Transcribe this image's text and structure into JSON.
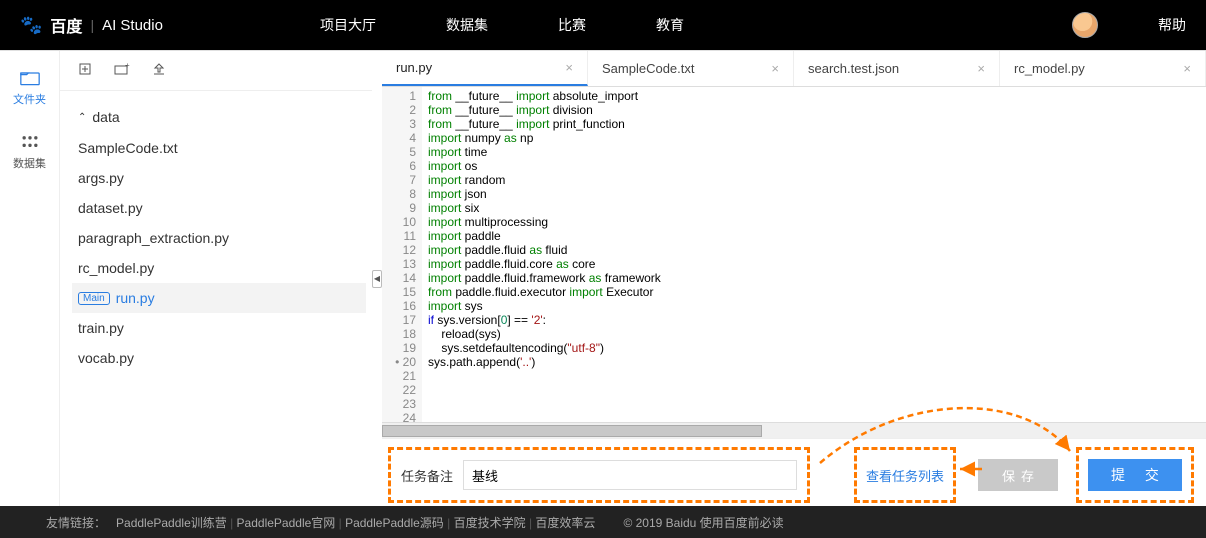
{
  "nav": {
    "logo_baidu": "百度",
    "logo_ai": "AI Studio",
    "links": [
      "项目大厅",
      "数据集",
      "比赛",
      "教育"
    ],
    "help": "帮助"
  },
  "iconbar": {
    "files": "文件夹",
    "datasets": "数据集"
  },
  "file_toolbar": {
    "new": "⧉",
    "newfolder": "📁+",
    "upload": "⇪"
  },
  "tree": {
    "folder": "data",
    "files": [
      "SampleCode.txt",
      "args.py",
      "dataset.py",
      "paragraph_extraction.py",
      "rc_model.py",
      "run.py",
      "train.py",
      "vocab.py"
    ],
    "main_badge": "Main",
    "active_file": "run.py"
  },
  "tabs": [
    {
      "label": "run.py",
      "active": true
    },
    {
      "label": "SampleCode.txt",
      "active": false
    },
    {
      "label": "search.test.json",
      "active": false
    },
    {
      "label": "rc_model.py",
      "active": false
    }
  ],
  "code_lines": [
    {
      "n": 1,
      "t": [
        [
          "kw",
          "from"
        ],
        [
          "",
          " __future__ "
        ],
        [
          "kw",
          "import"
        ],
        [
          "",
          " absolute_import"
        ]
      ]
    },
    {
      "n": 2,
      "t": [
        [
          "kw",
          "from"
        ],
        [
          "",
          " __future__ "
        ],
        [
          "kw",
          "import"
        ],
        [
          "",
          " division"
        ]
      ]
    },
    {
      "n": 3,
      "t": [
        [
          "kw",
          "from"
        ],
        [
          "",
          " __future__ "
        ],
        [
          "kw",
          "import"
        ],
        [
          "",
          " print_function"
        ]
      ]
    },
    {
      "n": 4,
      "t": [
        [
          "",
          ""
        ]
      ]
    },
    {
      "n": 5,
      "t": [
        [
          "kw",
          "import"
        ],
        [
          "",
          " numpy "
        ],
        [
          "kw",
          "as"
        ],
        [
          "",
          " np"
        ]
      ]
    },
    {
      "n": 6,
      "t": [
        [
          "kw",
          "import"
        ],
        [
          "",
          " time"
        ]
      ]
    },
    {
      "n": 7,
      "t": [
        [
          "kw",
          "import"
        ],
        [
          "",
          " os"
        ]
      ]
    },
    {
      "n": 8,
      "t": [
        [
          "kw",
          "import"
        ],
        [
          "",
          " random"
        ]
      ]
    },
    {
      "n": 9,
      "t": [
        [
          "kw",
          "import"
        ],
        [
          "",
          " json"
        ]
      ]
    },
    {
      "n": 10,
      "t": [
        [
          "kw",
          "import"
        ],
        [
          "",
          " six"
        ]
      ]
    },
    {
      "n": 11,
      "t": [
        [
          "kw",
          "import"
        ],
        [
          "",
          " multiprocessing"
        ]
      ]
    },
    {
      "n": 12,
      "t": [
        [
          "",
          ""
        ]
      ]
    },
    {
      "n": 13,
      "t": [
        [
          "kw",
          "import"
        ],
        [
          "",
          " paddle"
        ]
      ]
    },
    {
      "n": 14,
      "t": [
        [
          "kw",
          "import"
        ],
        [
          "",
          " paddle.fluid "
        ],
        [
          "kw",
          "as"
        ],
        [
          "",
          " fluid"
        ]
      ]
    },
    {
      "n": 15,
      "t": [
        [
          "kw",
          "import"
        ],
        [
          "",
          " paddle.fluid.core "
        ],
        [
          "kw",
          "as"
        ],
        [
          "",
          " core"
        ]
      ]
    },
    {
      "n": 16,
      "t": [
        [
          "kw",
          "import"
        ],
        [
          "",
          " paddle.fluid.framework "
        ],
        [
          "kw",
          "as"
        ],
        [
          "",
          " framework"
        ]
      ]
    },
    {
      "n": 17,
      "t": [
        [
          "kw",
          "from"
        ],
        [
          "",
          " paddle.fluid.executor "
        ],
        [
          "kw",
          "import"
        ],
        [
          "",
          " Executor"
        ]
      ]
    },
    {
      "n": 18,
      "t": [
        [
          "",
          ""
        ]
      ]
    },
    {
      "n": 19,
      "t": [
        [
          "kw",
          "import"
        ],
        [
          "",
          " sys"
        ]
      ]
    },
    {
      "n": 20,
      "bullet": true,
      "t": [
        [
          "kw2",
          "if"
        ],
        [
          "",
          " sys.version["
        ],
        [
          "num",
          "0"
        ],
        [
          "",
          "] == "
        ],
        [
          "str",
          "'2'"
        ],
        [
          "",
          ":"
        ]
      ]
    },
    {
      "n": 21,
      "t": [
        [
          "",
          "    reload(sys)"
        ]
      ]
    },
    {
      "n": 22,
      "t": [
        [
          "",
          "    sys.setdefaultencoding("
        ],
        [
          "str",
          "\"utf-8\""
        ],
        [
          "",
          ")"
        ]
      ]
    },
    {
      "n": 23,
      "t": [
        [
          "",
          "sys.path.append("
        ],
        [
          "str",
          "'..'"
        ],
        [
          "",
          ")"
        ]
      ]
    },
    {
      "n": 24,
      "t": [
        [
          "",
          ""
        ]
      ]
    }
  ],
  "bottom": {
    "remark_label": "任务备注",
    "remark_value": "基线",
    "view_list": "查看任务列表",
    "save": "保存",
    "submit": "提 交"
  },
  "footer": {
    "prefix": "友情链接：",
    "links": [
      "PaddlePaddle训练营",
      "PaddlePaddle官网",
      "PaddlePaddle源码",
      "百度技术学院",
      "百度效率云"
    ],
    "copyright": "© 2019 Baidu 使用百度前必读"
  }
}
